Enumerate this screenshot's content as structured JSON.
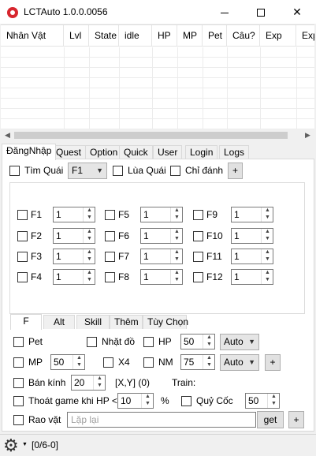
{
  "window": {
    "title": "LCTAuto 1.0.0.0056"
  },
  "grid": {
    "columns": [
      "Nhân Vật",
      "Lvl",
      "State",
      "idle",
      "HP",
      "MP",
      "Pet",
      "Câu?",
      "Exp",
      "Exp"
    ]
  },
  "tabs": [
    "ĐăngNhập",
    "Quest",
    "Option",
    "Quick",
    "User",
    "Login",
    "Logs"
  ],
  "top_row": {
    "tim_quai": "Tìm Quái",
    "f_select": "F1",
    "lua_quai": "Lùa Quái",
    "chi_danh": "Chỉ đánh",
    "plus": "+"
  },
  "skills": [
    {
      "key": "F1",
      "value": "1"
    },
    {
      "key": "F5",
      "value": "1"
    },
    {
      "key": "F9",
      "value": "1"
    },
    {
      "key": "F2",
      "value": "1"
    },
    {
      "key": "F6",
      "value": "1"
    },
    {
      "key": "F10",
      "value": "1"
    },
    {
      "key": "F3",
      "value": "1"
    },
    {
      "key": "F7",
      "value": "1"
    },
    {
      "key": "F11",
      "value": "1"
    },
    {
      "key": "F4",
      "value": "1"
    },
    {
      "key": "F8",
      "value": "1"
    },
    {
      "key": "F12",
      "value": "1"
    }
  ],
  "subtabs": [
    "F",
    "Alt",
    "Skill",
    "Thêm",
    "Tùy Chọn"
  ],
  "options": {
    "pet": "Pet",
    "nhat_do": "Nhặt đồ",
    "hp": "HP",
    "hp_value": "50",
    "hp_mode": "Auto",
    "mp": "MP",
    "mp_value": "50",
    "x4": "X4",
    "nm": "NM",
    "nm_value": "75",
    "nm_mode": "Auto",
    "plus": "+",
    "ban_kinh": "Bán kính",
    "ban_kinh_value": "20",
    "xy": "[X,Y] (0)",
    "train": "Train:",
    "thoat": "Thoát game khi HP <",
    "thoat_value": "10",
    "percent": "%",
    "quy_coc": "Quỷ Cốc",
    "quy_coc_value": "50",
    "rao_vat": "Rao vặt",
    "rao_placeholder": "Lặp lại",
    "get": "get",
    "plus2": "+"
  },
  "status": {
    "text": "[0/6-0]"
  }
}
